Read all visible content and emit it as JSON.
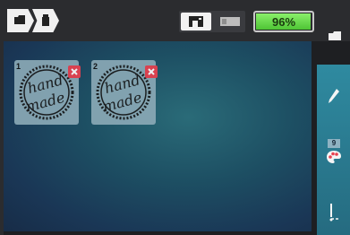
{
  "breadcrumb": {
    "items": [
      {
        "icon": "folder-icon"
      },
      {
        "icon": "machine-memory-icon"
      }
    ]
  },
  "status": {
    "battery_percent_label": "96%",
    "battery_level": 0.96
  },
  "designs": [
    {
      "number": "1",
      "line1": "hand",
      "line2": "made"
    },
    {
      "number": "2",
      "line1": "hand",
      "line2": "made"
    }
  ],
  "side_panel": {
    "thread_count": "9"
  },
  "colors": {
    "accent": "#2f8aa0",
    "battery_green": "#6fdc4e",
    "delete_red": "#e8414f"
  }
}
